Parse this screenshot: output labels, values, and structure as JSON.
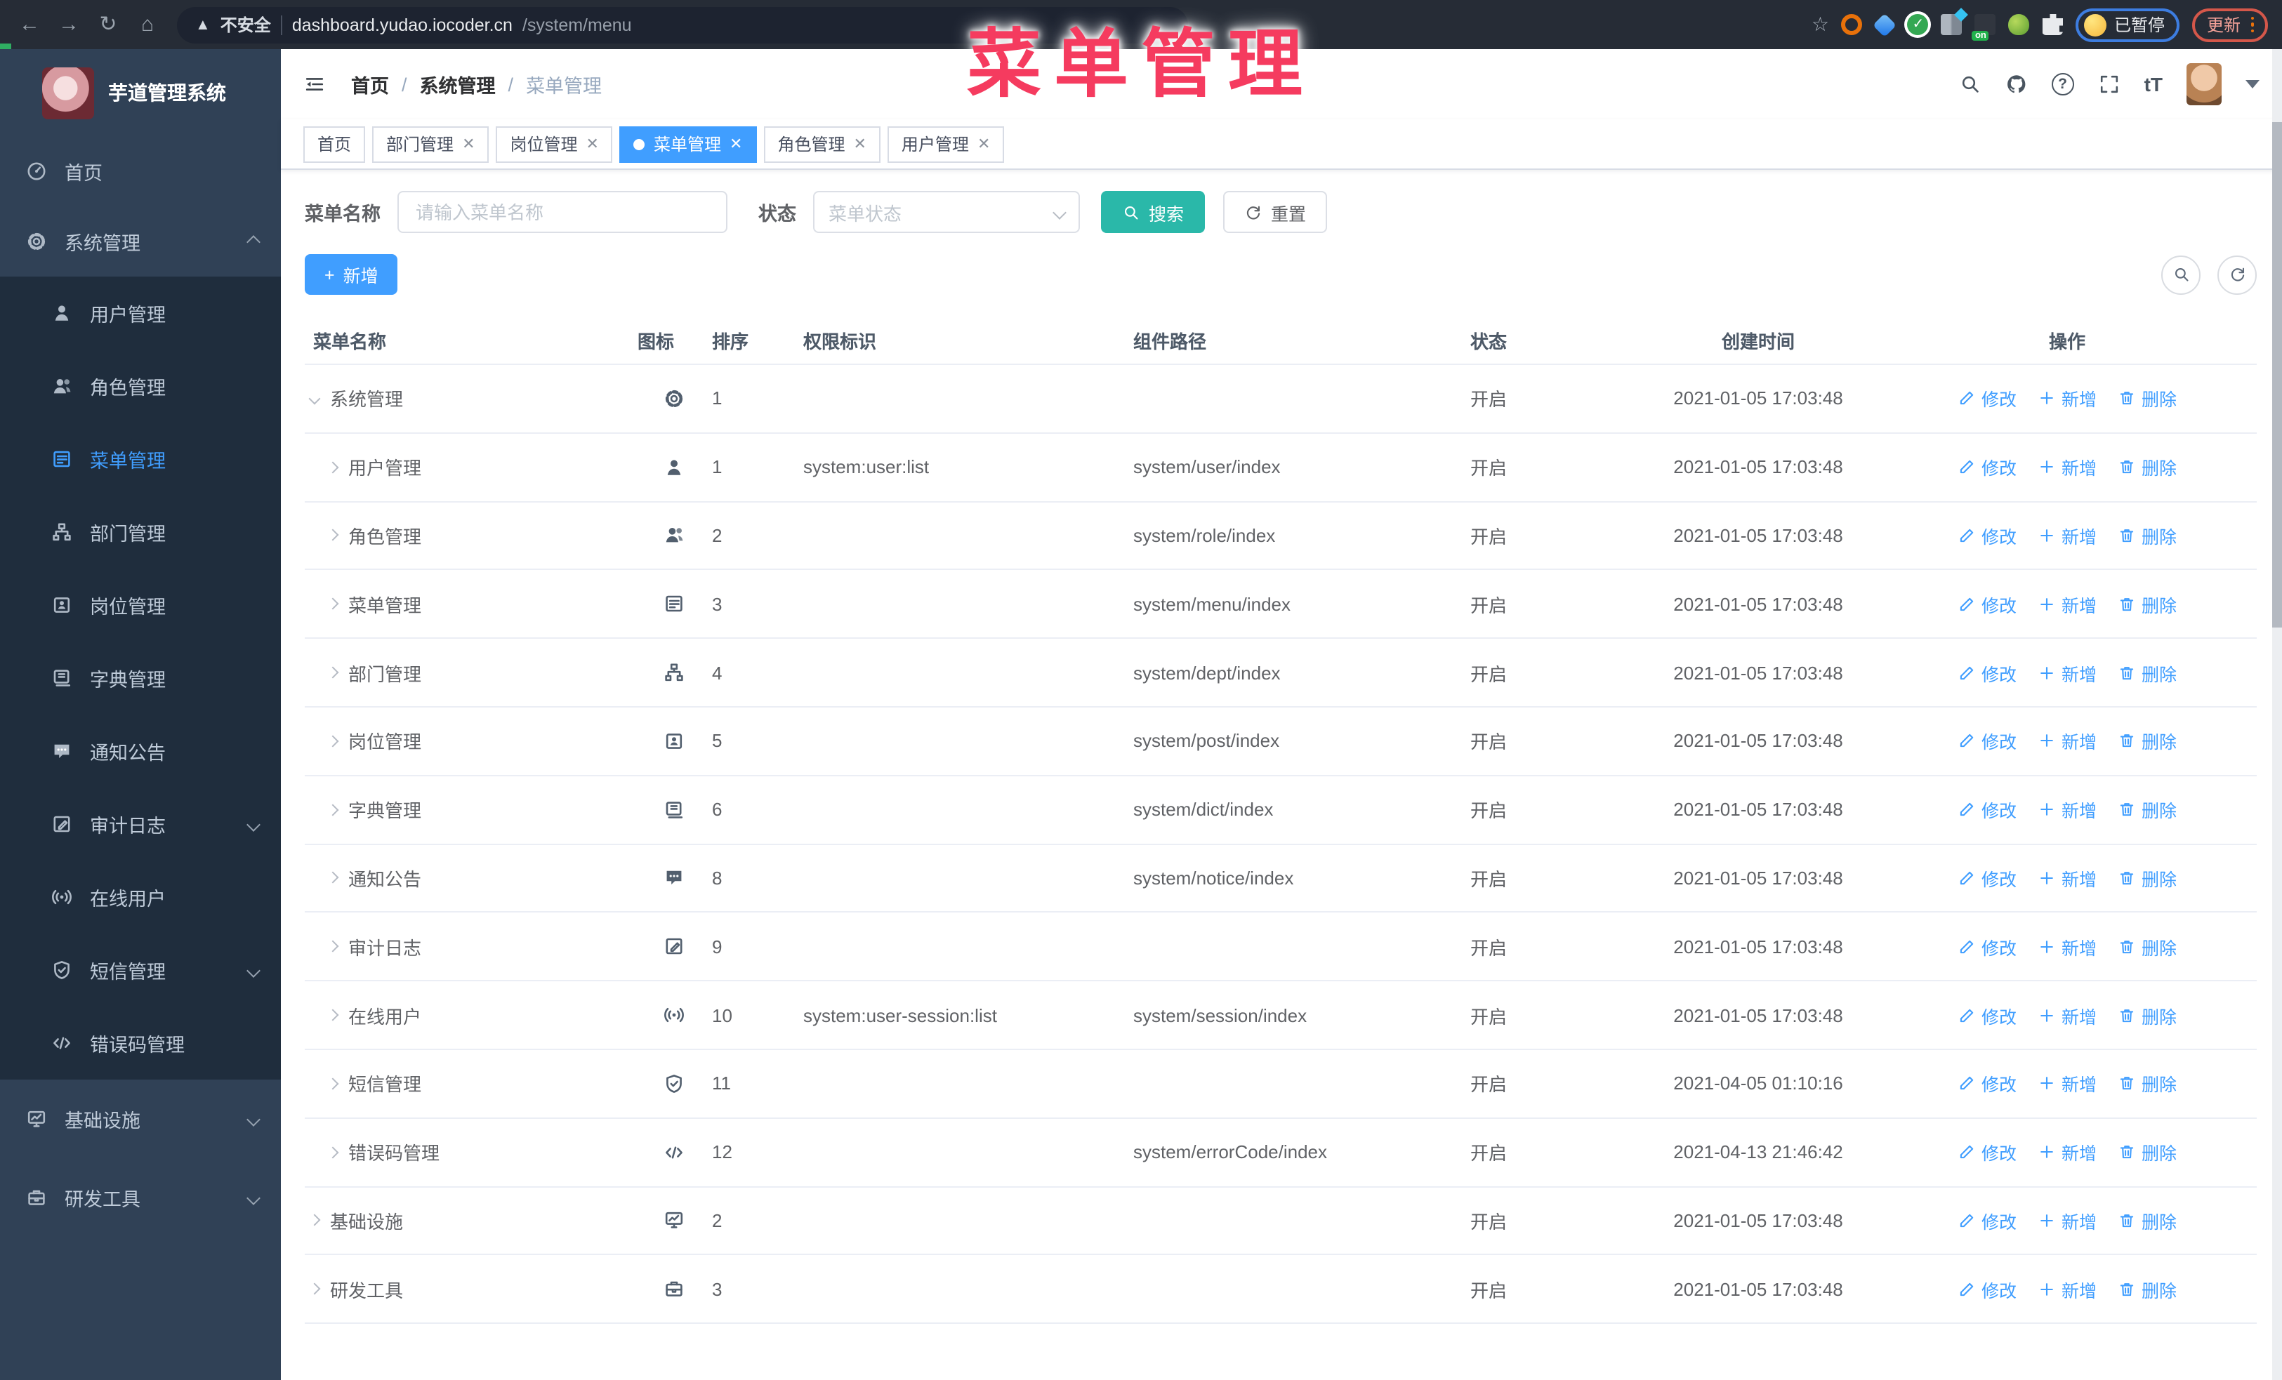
{
  "browser": {
    "security_label": "不安全",
    "url_host": "dashboard.yudao.iocoder.cn",
    "url_path": "/system/menu",
    "on_badge": "on",
    "paused_label": "已暂停",
    "update_label": "更新"
  },
  "overlay_title": "菜单管理",
  "sidebar": {
    "app_title": "芋道管理系统",
    "items": [
      {
        "label": "首页",
        "icon": "dashboard",
        "level": "top",
        "active": false,
        "chevron": null
      },
      {
        "label": "系统管理",
        "icon": "gear",
        "level": "top",
        "active": false,
        "chevron": "up"
      },
      {
        "label": "用户管理",
        "icon": "user",
        "level": "sub",
        "active": false,
        "chevron": null
      },
      {
        "label": "角色管理",
        "icon": "users",
        "level": "sub",
        "active": false,
        "chevron": null
      },
      {
        "label": "菜单管理",
        "icon": "menu",
        "level": "sub",
        "active": true,
        "chevron": null
      },
      {
        "label": "部门管理",
        "icon": "tree",
        "level": "sub",
        "active": false,
        "chevron": null
      },
      {
        "label": "岗位管理",
        "icon": "badge",
        "level": "sub",
        "active": false,
        "chevron": null
      },
      {
        "label": "字典管理",
        "icon": "dict",
        "level": "sub",
        "active": false,
        "chevron": null
      },
      {
        "label": "通知公告",
        "icon": "notice",
        "level": "sub",
        "active": false,
        "chevron": null
      },
      {
        "label": "审计日志",
        "icon": "log",
        "level": "sub",
        "active": false,
        "chevron": "down"
      },
      {
        "label": "在线用户",
        "icon": "online",
        "level": "sub",
        "active": false,
        "chevron": null
      },
      {
        "label": "短信管理",
        "icon": "sms",
        "level": "sub",
        "active": false,
        "chevron": "down"
      },
      {
        "label": "错误码管理",
        "icon": "code",
        "level": "sub",
        "active": false,
        "chevron": null
      },
      {
        "label": "基础设施",
        "icon": "infra",
        "level": "top2",
        "active": false,
        "chevron": "down"
      },
      {
        "label": "研发工具",
        "icon": "tool",
        "level": "top2",
        "active": false,
        "chevron": "down"
      }
    ]
  },
  "header": {
    "breadcrumb": [
      "首页",
      "系统管理",
      "菜单管理"
    ],
    "font_size_label": "tT"
  },
  "tabs": [
    {
      "label": "首页",
      "active": false,
      "closable": false
    },
    {
      "label": "部门管理",
      "active": false,
      "closable": true
    },
    {
      "label": "岗位管理",
      "active": false,
      "closable": true
    },
    {
      "label": "菜单管理",
      "active": true,
      "closable": true
    },
    {
      "label": "角色管理",
      "active": false,
      "closable": true
    },
    {
      "label": "用户管理",
      "active": false,
      "closable": true
    }
  ],
  "filters": {
    "name_label": "菜单名称",
    "name_placeholder": "请输入菜单名称",
    "status_label": "状态",
    "status_placeholder": "菜单状态",
    "search_label": "搜索",
    "reset_label": "重置"
  },
  "toolbar": {
    "add_label": "新增"
  },
  "table": {
    "columns": [
      "菜单名称",
      "图标",
      "排序",
      "权限标识",
      "组件路径",
      "状态",
      "创建时间",
      "操作"
    ],
    "action_labels": {
      "edit": "修改",
      "add": "新增",
      "del": "删除"
    },
    "rows": [
      {
        "name": "系统管理",
        "icon": "gear",
        "indent": 0,
        "arrow": "down",
        "sort": "1",
        "perm": "",
        "path": "",
        "status": "开启",
        "time": "2021-01-05 17:03:48"
      },
      {
        "name": "用户管理",
        "icon": "user",
        "indent": 1,
        "arrow": "right",
        "sort": "1",
        "perm": "system:user:list",
        "path": "system/user/index",
        "status": "开启",
        "time": "2021-01-05 17:03:48"
      },
      {
        "name": "角色管理",
        "icon": "users",
        "indent": 1,
        "arrow": "right",
        "sort": "2",
        "perm": "",
        "path": "system/role/index",
        "status": "开启",
        "time": "2021-01-05 17:03:48"
      },
      {
        "name": "菜单管理",
        "icon": "menu",
        "indent": 1,
        "arrow": "right",
        "sort": "3",
        "perm": "",
        "path": "system/menu/index",
        "status": "开启",
        "time": "2021-01-05 17:03:48"
      },
      {
        "name": "部门管理",
        "icon": "tree",
        "indent": 1,
        "arrow": "right",
        "sort": "4",
        "perm": "",
        "path": "system/dept/index",
        "status": "开启",
        "time": "2021-01-05 17:03:48"
      },
      {
        "name": "岗位管理",
        "icon": "badge",
        "indent": 1,
        "arrow": "right",
        "sort": "5",
        "perm": "",
        "path": "system/post/index",
        "status": "开启",
        "time": "2021-01-05 17:03:48"
      },
      {
        "name": "字典管理",
        "icon": "dict",
        "indent": 1,
        "arrow": "right",
        "sort": "6",
        "perm": "",
        "path": "system/dict/index",
        "status": "开启",
        "time": "2021-01-05 17:03:48"
      },
      {
        "name": "通知公告",
        "icon": "notice",
        "indent": 1,
        "arrow": "right",
        "sort": "8",
        "perm": "",
        "path": "system/notice/index",
        "status": "开启",
        "time": "2021-01-05 17:03:48"
      },
      {
        "name": "审计日志",
        "icon": "log",
        "indent": 1,
        "arrow": "right",
        "sort": "9",
        "perm": "",
        "path": "",
        "status": "开启",
        "time": "2021-01-05 17:03:48"
      },
      {
        "name": "在线用户",
        "icon": "online",
        "indent": 1,
        "arrow": "right",
        "sort": "10",
        "perm": "system:user-session:list",
        "path": "system/session/index",
        "status": "开启",
        "time": "2021-01-05 17:03:48"
      },
      {
        "name": "短信管理",
        "icon": "sms",
        "indent": 1,
        "arrow": "right",
        "sort": "11",
        "perm": "",
        "path": "",
        "status": "开启",
        "time": "2021-04-05 01:10:16"
      },
      {
        "name": "错误码管理",
        "icon": "code",
        "indent": 1,
        "arrow": "right",
        "sort": "12",
        "perm": "",
        "path": "system/errorCode/index",
        "status": "开启",
        "time": "2021-04-13 21:46:42"
      },
      {
        "name": "基础设施",
        "icon": "infra",
        "indent": 0,
        "arrow": "right",
        "sort": "2",
        "perm": "",
        "path": "",
        "status": "开启",
        "time": "2021-01-05 17:03:48"
      },
      {
        "name": "研发工具",
        "icon": "tool",
        "indent": 0,
        "arrow": "right",
        "sort": "3",
        "perm": "",
        "path": "",
        "status": "开启",
        "time": "2021-01-05 17:03:48"
      }
    ]
  },
  "colors": {
    "accent_blue": "#409eff",
    "search_teal": "#2ab8a9",
    "overlay_red": "#f53b5f",
    "sidebar_bg": "#304156",
    "submenu_bg": "#1f2d3d"
  }
}
